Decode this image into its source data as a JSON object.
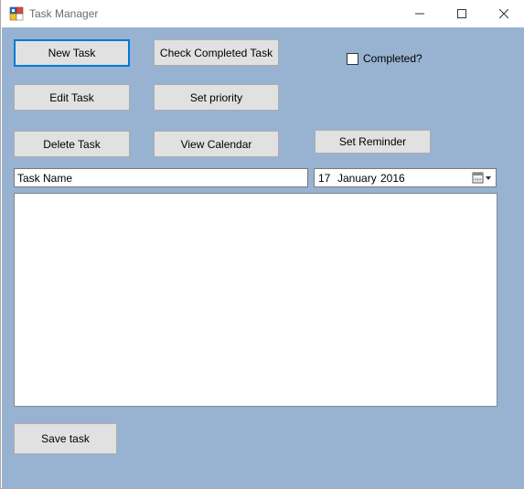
{
  "window": {
    "title": "Task Manager"
  },
  "buttons": {
    "new_task": "New Task",
    "check_completed": "Check Completed Task",
    "edit_task": "Edit Task",
    "set_priority": "Set priority",
    "delete_task": "Delete Task",
    "view_calendar": "View Calendar",
    "set_reminder": "Set Reminder",
    "save_task": "Save task"
  },
  "completed_checkbox": {
    "label": "Completed?",
    "checked": false
  },
  "task_name": {
    "value": "Task Name"
  },
  "date_picker": {
    "day": "17",
    "month": "January",
    "year": "2016"
  },
  "colors": {
    "client_background": "#98b2d1",
    "button_face": "#e1e1e1",
    "focus_border": "#0078d7"
  },
  "icons": {
    "app": "task-manager-app-icon",
    "minimize": "minimize-icon",
    "maximize": "maximize-icon",
    "close": "close-icon",
    "calendar": "calendar-dropdown-icon"
  }
}
